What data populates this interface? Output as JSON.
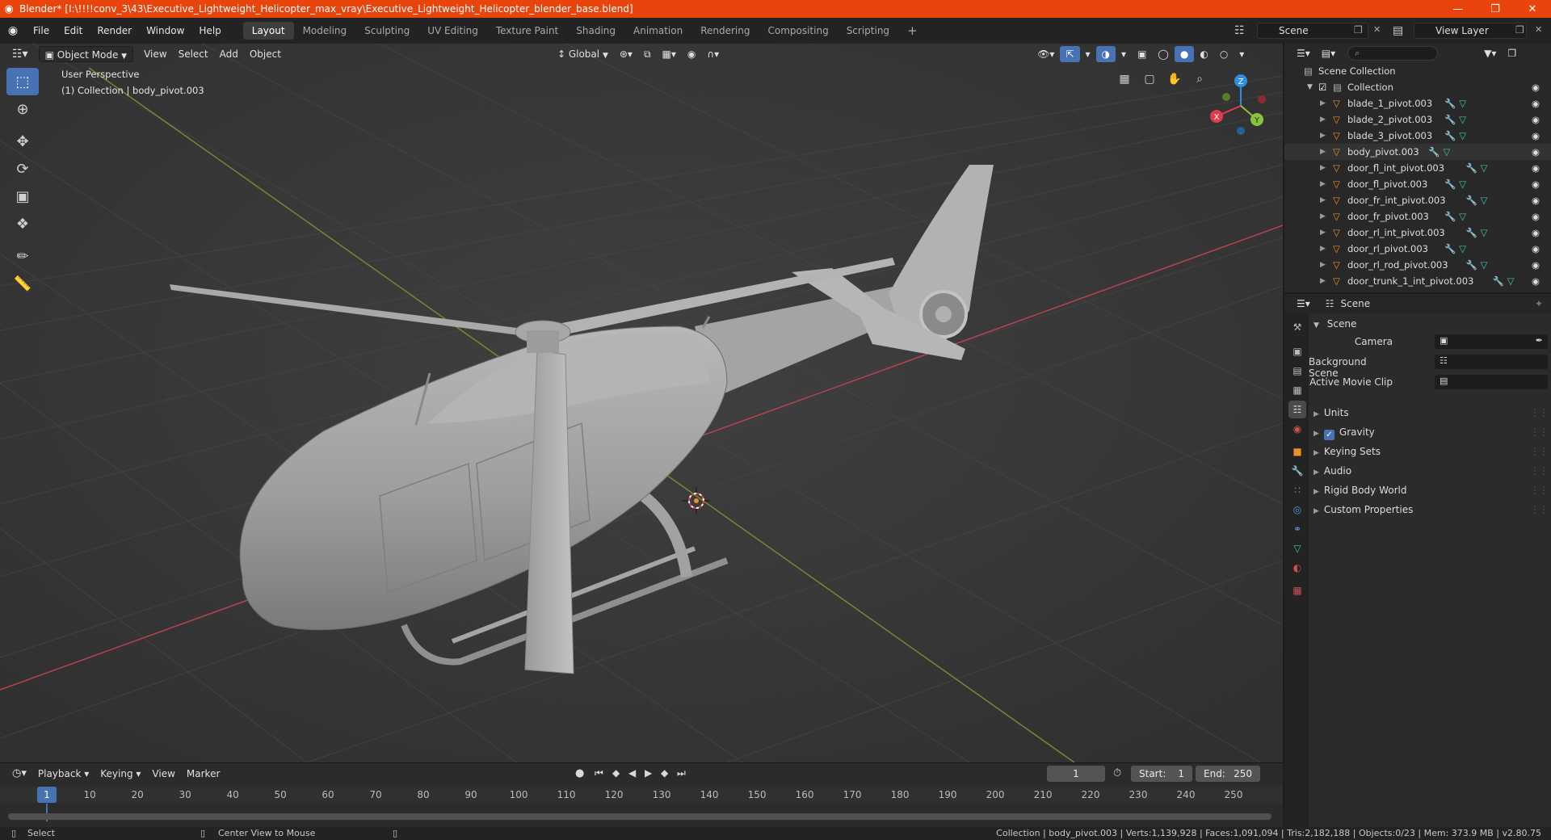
{
  "window": {
    "title": "Blender* [I:\\!!!!conv_3\\43\\Executive_Lightweight_Helicopter_max_vray\\Executive_Lightweight_Helicopter_blender_base.blend]",
    "minimize": "—",
    "maximize": "❐",
    "close": "✕"
  },
  "menu": [
    "File",
    "Edit",
    "Render",
    "Window",
    "Help"
  ],
  "workspaces": [
    "Layout",
    "Modeling",
    "Sculpting",
    "UV Editing",
    "Texture Paint",
    "Shading",
    "Animation",
    "Rendering",
    "Compositing",
    "Scripting"
  ],
  "workspace_add": "+",
  "scene_selector": "Scene",
  "view_layer": "View Layer",
  "viewport": {
    "mode": "Object Mode",
    "menus": [
      "View",
      "Select",
      "Add",
      "Object"
    ],
    "orientation": "Global",
    "view_name": "User Perspective",
    "collection_info": "(1) Collection | body_pivot.003",
    "gizmo_axes": {
      "x": "X",
      "y": "Y",
      "z": "Z"
    }
  },
  "timeline": {
    "menus": [
      "Playback",
      "Keying",
      "View",
      "Marker"
    ],
    "current_frame": "1",
    "start_label": "Start:",
    "start": "1",
    "end_label": "End:",
    "end": "250",
    "ruler": [
      "1",
      "10",
      "20",
      "30",
      "40",
      "50",
      "60",
      "70",
      "80",
      "90",
      "100",
      "110",
      "120",
      "130",
      "140",
      "150",
      "160",
      "170",
      "180",
      "190",
      "200",
      "210",
      "220",
      "230",
      "240",
      "250"
    ]
  },
  "status": {
    "left_action": "Select",
    "mid_action": "Center View to Mouse",
    "stats": "Collection | body_pivot.003 | Verts:1,139,928 | Faces:1,091,094 | Tris:2,182,188 | Objects:0/23 | Mem: 373.9 MB | v2.80.75"
  },
  "outliner": {
    "root": "Scene Collection",
    "collection": "Collection",
    "items": [
      "blade_1_pivot.003",
      "blade_2_pivot.003",
      "blade_3_pivot.003",
      "body_pivot.003",
      "door_fl_int_pivot.003",
      "door_fl_pivot.003",
      "door_fr_int_pivot.003",
      "door_fr_pivot.003",
      "door_rl_int_pivot.003",
      "door_rl_pivot.003",
      "door_rl_rod_pivot.003",
      "door_trunk_1_int_pivot.003"
    ]
  },
  "properties": {
    "context": "Scene",
    "section": "Scene",
    "camera_label": "Camera",
    "background_label": "Background Scene",
    "movie_clip_label": "Active Movie Clip",
    "subsections": [
      "Units",
      "Gravity",
      "Keying Sets",
      "Audio",
      "Rigid Body World",
      "Custom Properties"
    ]
  },
  "colors": {
    "titlebar": "#e8440c",
    "accent": "#4772b3",
    "axis_x": "#e03c4a",
    "axis_y": "#8ac43f",
    "axis_z": "#2c8fe0",
    "object_orange": "#e8912d",
    "mesh_teal": "#3ec9a8"
  }
}
